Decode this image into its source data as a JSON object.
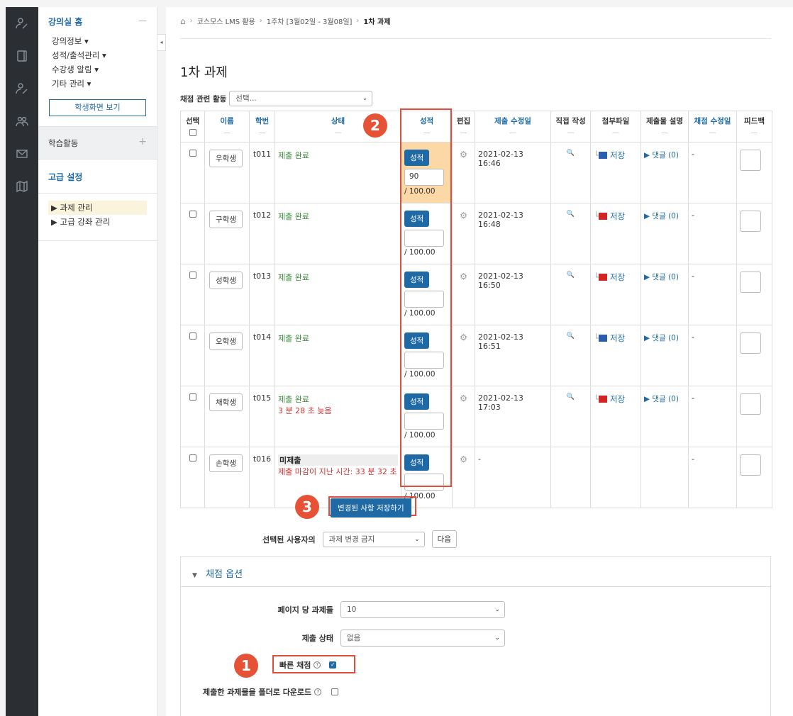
{
  "rail": {
    "icons": [
      "person-pen-icon",
      "notebook-icon",
      "person-pen-icon",
      "users-icon",
      "mail-icon",
      "map-icon"
    ]
  },
  "sidebar": {
    "home_label": "강의실 홈",
    "menu": [
      "강의정보 ▾",
      "성적/출석관리 ▾",
      "수강생 알림 ▾",
      "기타 관리 ▾"
    ],
    "student_view_label": "학생화면 보기",
    "activities_label": "학습활동",
    "advanced_label": "고급 설정",
    "advanced_items": [
      "▶ 과제 관리",
      "▶ 고급 강좌 관리"
    ]
  },
  "breadcrumb": {
    "items": [
      "코스모스 LMS 활용",
      "1주차 [3월02일 - 3월08일]",
      "1차 과제"
    ]
  },
  "page": {
    "title": "1차 과제",
    "grading_action_label": "채점 관련 활동",
    "grading_action_value": "선택..."
  },
  "table": {
    "headers": {
      "select": "선택",
      "name": "이름",
      "idnumber": "학번",
      "status": "상태",
      "grade": "성적",
      "edit": "편집",
      "modified": "제출 수정일",
      "onlinetext": "직접 작성",
      "files": "첨부파일",
      "comments": "제출물 설명",
      "grade_modified": "채점 수정일",
      "feedback": "피드백"
    },
    "grade_button_label": "성적",
    "rows": [
      {
        "name": "우학생",
        "id": "t011",
        "status": "제출 완료",
        "status2": "",
        "grade_value": "90",
        "grade_max": "/ 100.00",
        "modified": "2021-02-13 16:46",
        "file": "저장",
        "file_type": "word",
        "comment": "▶ 댓글 (0)",
        "grade_modified": "-"
      },
      {
        "name": "구학생",
        "id": "t012",
        "status": "제출 완료",
        "status2": "",
        "grade_value": "",
        "grade_max": "/ 100.00",
        "modified": "2021-02-13 16:48",
        "file": "저장",
        "file_type": "pdf",
        "comment": "▶ 댓글 (0)",
        "grade_modified": "-"
      },
      {
        "name": "성학생",
        "id": "t013",
        "status": "제출 완료",
        "status2": "",
        "grade_value": "",
        "grade_max": "/ 100.00",
        "modified": "2021-02-13 16:50",
        "file": "저장",
        "file_type": "pdf",
        "comment": "▶ 댓글 (0)",
        "grade_modified": "-"
      },
      {
        "name": "오학생",
        "id": "t014",
        "status": "제출 완료",
        "status2": "",
        "grade_value": "",
        "grade_max": "/ 100.00",
        "modified": "2021-02-13 16:51",
        "file": "저장",
        "file_type": "word",
        "comment": "▶ 댓글 (0)",
        "grade_modified": "-"
      },
      {
        "name": "채학생",
        "id": "t015",
        "status": "제출 완료",
        "status2": "3 분 28 초 늦음",
        "grade_value": "",
        "grade_max": "/ 100.00",
        "modified": "2021-02-13 17:03",
        "file": "저장",
        "file_type": "pdf",
        "comment": "▶ 댓글 (0)",
        "grade_modified": "-"
      },
      {
        "name": "손학생",
        "id": "t016",
        "status": "미제출",
        "status2": "제출 마감이 지난 시간: 33 분 32 초",
        "grade_value": "",
        "grade_max": "/ 100.00",
        "modified": "-",
        "file": "",
        "file_type": "",
        "comment": "",
        "grade_modified": "-"
      }
    ]
  },
  "actions": {
    "save_label": "변경된 사항 저장하기",
    "with_selected_label": "선택된 사용자의",
    "with_selected_value": "과제 변경 금지",
    "next_label": "다음"
  },
  "options": {
    "title": "채점 옵션",
    "per_page_label": "페이지 당 과제들",
    "per_page_value": "10",
    "filter_label": "제출 상태",
    "filter_value": "없음",
    "quick_grading_label": "빠른 채점",
    "quick_grading_checked": true,
    "download_folders_label": "제출한 과제물을 폴더로 다운로드",
    "download_folders_checked": false
  },
  "annotations": {
    "step1": "1",
    "step2": "2",
    "step3": "3"
  },
  "colors": {
    "accent": "#1f6aa5",
    "highlight": "#fbd8a6",
    "annotation": "#e55235",
    "success": "#3a8a3a",
    "late": "#d43030"
  }
}
